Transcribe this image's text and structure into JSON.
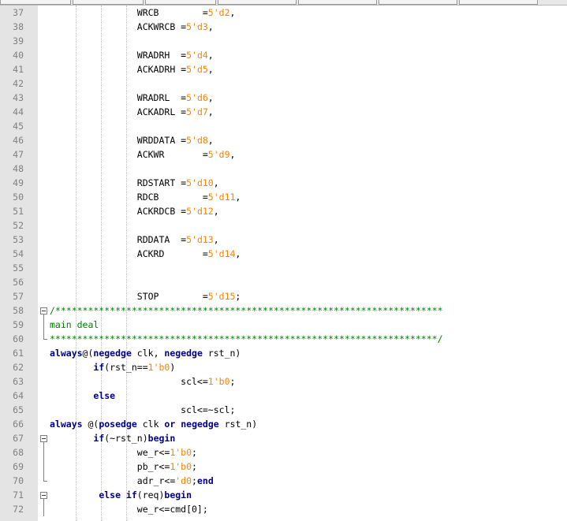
{
  "editor": {
    "lines": [
      {
        "no": "37",
        "tokens": [
          {
            "t": "                WRCB        =",
            "c": ""
          },
          {
            "t": "5'd2",
            "c": "n"
          },
          {
            "t": ",",
            "c": ""
          }
        ]
      },
      {
        "no": "38",
        "tokens": [
          {
            "t": "                ACKWRCB =",
            "c": ""
          },
          {
            "t": "5'd3",
            "c": "n"
          },
          {
            "t": ",",
            "c": ""
          }
        ]
      },
      {
        "no": "39",
        "tokens": []
      },
      {
        "no": "40",
        "tokens": [
          {
            "t": "                WRADRH  =",
            "c": ""
          },
          {
            "t": "5'd4",
            "c": "n"
          },
          {
            "t": ",",
            "c": ""
          }
        ]
      },
      {
        "no": "41",
        "tokens": [
          {
            "t": "                ACKADRH =",
            "c": ""
          },
          {
            "t": "5'd5",
            "c": "n"
          },
          {
            "t": ",",
            "c": ""
          }
        ]
      },
      {
        "no": "42",
        "tokens": []
      },
      {
        "no": "43",
        "tokens": [
          {
            "t": "                WRADRL  =",
            "c": ""
          },
          {
            "t": "5'd6",
            "c": "n"
          },
          {
            "t": ",",
            "c": ""
          }
        ]
      },
      {
        "no": "44",
        "tokens": [
          {
            "t": "                ACKADRL =",
            "c": ""
          },
          {
            "t": "5'd7",
            "c": "n"
          },
          {
            "t": ",",
            "c": ""
          }
        ]
      },
      {
        "no": "45",
        "tokens": []
      },
      {
        "no": "46",
        "tokens": [
          {
            "t": "                WRDDATA =",
            "c": ""
          },
          {
            "t": "5'd8",
            "c": "n"
          },
          {
            "t": ",",
            "c": ""
          }
        ]
      },
      {
        "no": "47",
        "tokens": [
          {
            "t": "                ACKWR       =",
            "c": ""
          },
          {
            "t": "5'd9",
            "c": "n"
          },
          {
            "t": ",",
            "c": ""
          }
        ]
      },
      {
        "no": "48",
        "tokens": []
      },
      {
        "no": "49",
        "tokens": [
          {
            "t": "                RDSTART =",
            "c": ""
          },
          {
            "t": "5'd10",
            "c": "n"
          },
          {
            "t": ",",
            "c": ""
          }
        ]
      },
      {
        "no": "50",
        "tokens": [
          {
            "t": "                RDCB        =",
            "c": ""
          },
          {
            "t": "5'd11",
            "c": "n"
          },
          {
            "t": ",",
            "c": ""
          }
        ]
      },
      {
        "no": "51",
        "tokens": [
          {
            "t": "                ACKRDCB =",
            "c": ""
          },
          {
            "t": "5'd12",
            "c": "n"
          },
          {
            "t": ",",
            "c": ""
          }
        ]
      },
      {
        "no": "52",
        "tokens": []
      },
      {
        "no": "53",
        "tokens": [
          {
            "t": "                RDDATA  =",
            "c": ""
          },
          {
            "t": "5'd13",
            "c": "n"
          },
          {
            "t": ",",
            "c": ""
          }
        ]
      },
      {
        "no": "54",
        "tokens": [
          {
            "t": "                ACKRD       =",
            "c": ""
          },
          {
            "t": "5'd14",
            "c": "n"
          },
          {
            "t": ",",
            "c": ""
          }
        ]
      },
      {
        "no": "55",
        "tokens": []
      },
      {
        "no": "56",
        "tokens": []
      },
      {
        "no": "57",
        "tokens": [
          {
            "t": "                STOP        =",
            "c": ""
          },
          {
            "t": "5'd15",
            "c": "n"
          },
          {
            "t": ";",
            "c": ""
          }
        ]
      },
      {
        "no": "58",
        "tokens": [
          {
            "t": "/***********************************************************************",
            "c": "c"
          }
        ]
      },
      {
        "no": "59",
        "tokens": [
          {
            "t": "main deal",
            "c": "c"
          }
        ]
      },
      {
        "no": "60",
        "tokens": [
          {
            "t": "***********************************************************************/",
            "c": "c"
          }
        ]
      },
      {
        "no": "61",
        "tokens": [
          {
            "t": "always",
            "c": "k"
          },
          {
            "t": "@(",
            "c": ""
          },
          {
            "t": "negedge",
            "c": "k"
          },
          {
            "t": " clk, ",
            "c": ""
          },
          {
            "t": "negedge",
            "c": "k"
          },
          {
            "t": " rst_n)",
            "c": ""
          }
        ]
      },
      {
        "no": "62",
        "tokens": [
          {
            "t": "        ",
            "c": ""
          },
          {
            "t": "if",
            "c": "k"
          },
          {
            "t": "(rst_n==",
            "c": ""
          },
          {
            "t": "1'b0",
            "c": "n"
          },
          {
            "t": ")",
            "c": ""
          }
        ]
      },
      {
        "no": "63",
        "tokens": [
          {
            "t": "                        scl<=",
            "c": ""
          },
          {
            "t": "1'b0",
            "c": "n"
          },
          {
            "t": ";",
            "c": ""
          }
        ]
      },
      {
        "no": "64",
        "tokens": [
          {
            "t": "        ",
            "c": ""
          },
          {
            "t": "else",
            "c": "k"
          }
        ]
      },
      {
        "no": "65",
        "tokens": [
          {
            "t": "                        scl<=~scl;",
            "c": ""
          }
        ]
      },
      {
        "no": "66",
        "tokens": [
          {
            "t": "always",
            "c": "k"
          },
          {
            "t": " @(",
            "c": ""
          },
          {
            "t": "posedge",
            "c": "k"
          },
          {
            "t": " clk ",
            "c": ""
          },
          {
            "t": "or",
            "c": "k"
          },
          {
            "t": " ",
            "c": ""
          },
          {
            "t": "negedge",
            "c": "k"
          },
          {
            "t": " rst_n)",
            "c": ""
          }
        ]
      },
      {
        "no": "67",
        "tokens": [
          {
            "t": "        ",
            "c": ""
          },
          {
            "t": "if",
            "c": "k"
          },
          {
            "t": "(~rst_n)",
            "c": ""
          },
          {
            "t": "begin",
            "c": "k"
          }
        ]
      },
      {
        "no": "68",
        "tokens": [
          {
            "t": "                we_r<=",
            "c": ""
          },
          {
            "t": "1'b0",
            "c": "n"
          },
          {
            "t": ";",
            "c": ""
          }
        ]
      },
      {
        "no": "69",
        "tokens": [
          {
            "t": "                pb_r<=",
            "c": ""
          },
          {
            "t": "1'b0",
            "c": "n"
          },
          {
            "t": ";",
            "c": ""
          }
        ]
      },
      {
        "no": "70",
        "tokens": [
          {
            "t": "                adr_r<=",
            "c": ""
          },
          {
            "t": "'d0",
            "c": "n"
          },
          {
            "t": ";",
            "c": ""
          },
          {
            "t": "end",
            "c": "k"
          }
        ]
      },
      {
        "no": "71",
        "tokens": [
          {
            "t": "         ",
            "c": ""
          },
          {
            "t": "else if",
            "c": "k"
          },
          {
            "t": "(req)",
            "c": ""
          },
          {
            "t": "begin",
            "c": "k"
          }
        ]
      },
      {
        "no": "72",
        "tokens": [
          {
            "t": "                we_r<=cmd[0];",
            "c": ""
          }
        ]
      }
    ],
    "folds": {
      "58": "box",
      "59": "line",
      "60": "end",
      "61": "",
      "67": "box",
      "68": "line",
      "69": "line",
      "70": "end",
      "71": "box",
      "72": "line"
    },
    "colors": {
      "keyword": "#00007f",
      "number": "#ff8000",
      "comment": "#008000",
      "gutter": "#e4e4e4",
      "line_number": "#808080"
    }
  }
}
